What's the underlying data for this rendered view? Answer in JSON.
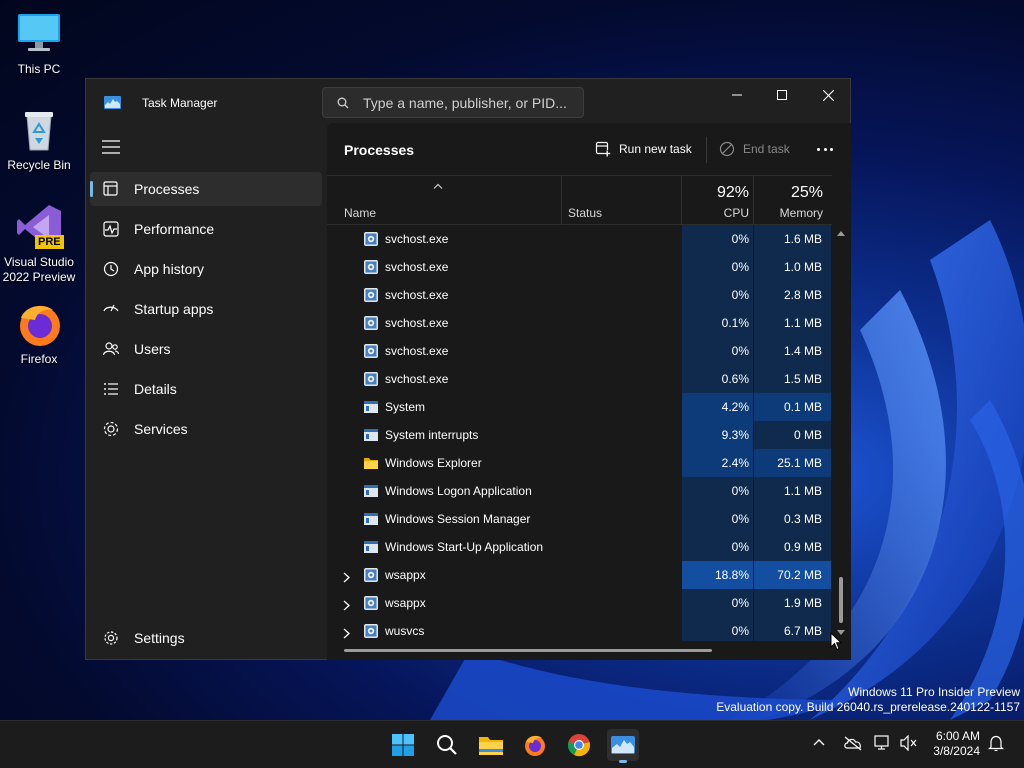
{
  "desktop": {
    "icons": [
      {
        "label": "This PC",
        "icon": "monitor-icon"
      },
      {
        "label": "Recycle Bin",
        "icon": "recycle-bin-icon"
      },
      {
        "label": "Visual Studio\n2022 Preview",
        "icon": "visual-studio-icon",
        "badge": "PRE"
      },
      {
        "label": "Firefox",
        "icon": "firefox-icon"
      }
    ],
    "watermark": {
      "line1": "Windows 11 Pro Insider Preview",
      "line2": "Evaluation copy. Build 26040.rs_prerelease.240122-1157"
    }
  },
  "window": {
    "title": "Task Manager",
    "search_placeholder": "Type a name, publisher, or PID..."
  },
  "sidebar": {
    "items": [
      {
        "label": "Processes",
        "icon": "processes-icon",
        "active": true
      },
      {
        "label": "Performance",
        "icon": "performance-icon",
        "active": false
      },
      {
        "label": "App history",
        "icon": "app-history-icon",
        "active": false
      },
      {
        "label": "Startup apps",
        "icon": "startup-apps-icon",
        "active": false
      },
      {
        "label": "Users",
        "icon": "users-icon",
        "active": false
      },
      {
        "label": "Details",
        "icon": "details-icon",
        "active": false
      },
      {
        "label": "Services",
        "icon": "services-icon",
        "active": false
      }
    ],
    "settings_label": "Settings"
  },
  "toolbar": {
    "title": "Processes",
    "run_new_task": "Run new task",
    "end_task": "End task"
  },
  "table": {
    "headers": {
      "name": "Name",
      "status": "Status",
      "cpu_total": "92%",
      "cpu": "CPU",
      "memory_total": "25%",
      "memory": "Memory"
    },
    "rows": [
      {
        "name": "svchost.exe",
        "icon": "service-host-icon",
        "expandable": false,
        "cpu": "0%",
        "memory": "1.6 MB",
        "cpu_heat": 0,
        "mem_heat": 0
      },
      {
        "name": "svchost.exe",
        "icon": "service-host-icon",
        "expandable": false,
        "cpu": "0%",
        "memory": "1.0 MB",
        "cpu_heat": 0,
        "mem_heat": 0
      },
      {
        "name": "svchost.exe",
        "icon": "service-host-icon",
        "expandable": false,
        "cpu": "0%",
        "memory": "2.8 MB",
        "cpu_heat": 0,
        "mem_heat": 0
      },
      {
        "name": "svchost.exe",
        "icon": "service-host-icon",
        "expandable": false,
        "cpu": "0.1%",
        "memory": "1.1 MB",
        "cpu_heat": 0,
        "mem_heat": 0
      },
      {
        "name": "svchost.exe",
        "icon": "service-host-icon",
        "expandable": false,
        "cpu": "0%",
        "memory": "1.4 MB",
        "cpu_heat": 0,
        "mem_heat": 0
      },
      {
        "name": "svchost.exe",
        "icon": "service-host-icon",
        "expandable": false,
        "cpu": "0.6%",
        "memory": "1.5 MB",
        "cpu_heat": 0,
        "mem_heat": 0
      },
      {
        "name": "System",
        "icon": "system-window-icon",
        "expandable": false,
        "cpu": "4.2%",
        "memory": "0.1 MB",
        "cpu_heat": 1,
        "mem_heat": 1
      },
      {
        "name": "System interrupts",
        "icon": "system-window-icon",
        "expandable": false,
        "cpu": "9.3%",
        "memory": "0 MB",
        "cpu_heat": 1,
        "mem_heat": 0
      },
      {
        "name": "Windows Explorer",
        "icon": "folder-icon",
        "expandable": false,
        "cpu": "2.4%",
        "memory": "25.1 MB",
        "cpu_heat": 1,
        "mem_heat": 1
      },
      {
        "name": "Windows Logon Application",
        "icon": "system-window-icon",
        "expandable": false,
        "cpu": "0%",
        "memory": "1.1 MB",
        "cpu_heat": 0,
        "mem_heat": 0
      },
      {
        "name": "Windows Session Manager",
        "icon": "system-window-icon",
        "expandable": false,
        "cpu": "0%",
        "memory": "0.3 MB",
        "cpu_heat": 0,
        "mem_heat": 0
      },
      {
        "name": "Windows Start-Up Application",
        "icon": "system-window-icon",
        "expandable": false,
        "cpu": "0%",
        "memory": "0.9 MB",
        "cpu_heat": 0,
        "mem_heat": 0
      },
      {
        "name": "wsappx",
        "icon": "service-host-icon",
        "expandable": true,
        "cpu": "18.8%",
        "memory": "70.2 MB",
        "cpu_heat": 2,
        "mem_heat": 2
      },
      {
        "name": "wsappx",
        "icon": "service-host-icon",
        "expandable": true,
        "cpu": "0%",
        "memory": "1.9 MB",
        "cpu_heat": 0,
        "mem_heat": 0
      },
      {
        "name": "wusvcs",
        "icon": "service-host-icon",
        "expandable": true,
        "cpu": "0%",
        "memory": "6.7 MB",
        "cpu_heat": 0,
        "mem_heat": 0
      }
    ]
  },
  "taskbar": {
    "apps": [
      {
        "icon": "windows-start-icon"
      },
      {
        "icon": "search-icon"
      },
      {
        "icon": "file-explorer-icon"
      },
      {
        "icon": "firefox-icon"
      },
      {
        "icon": "chrome-icon"
      },
      {
        "icon": "task-manager-icon",
        "active": true
      }
    ],
    "time": "6:00 AM",
    "date": "3/8/2024"
  },
  "colors": {
    "heat": [
      "#0f2a4d",
      "#0d3a78",
      "#134ea0"
    ],
    "accent": "#76b9ed"
  }
}
